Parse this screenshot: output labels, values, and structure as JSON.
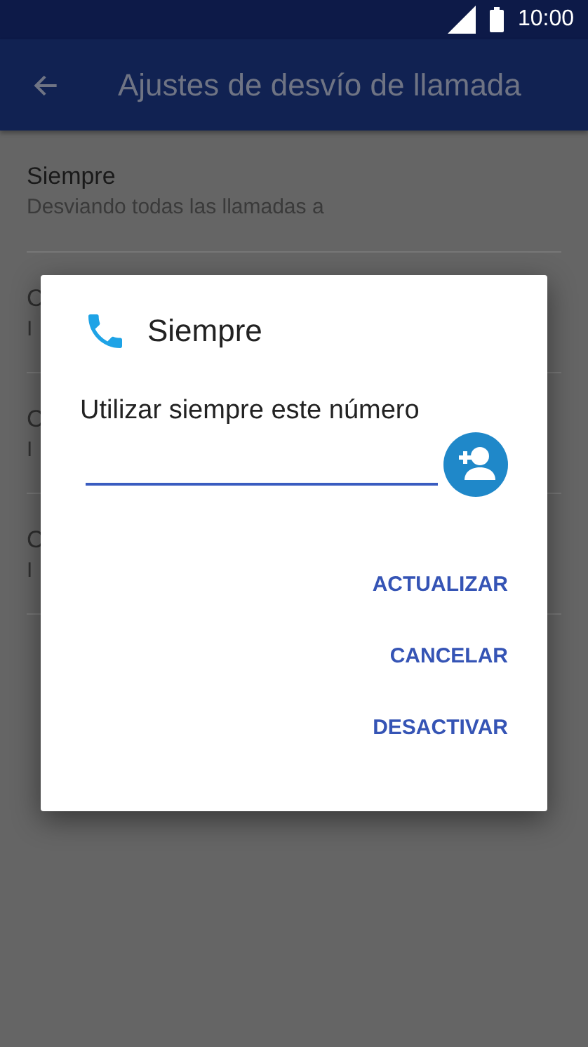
{
  "status_bar": {
    "time": "10:00"
  },
  "toolbar": {
    "title": "Ajustes de desvío de llamada"
  },
  "settings": [
    {
      "title": "Siempre",
      "subtitle": "Desviando todas las llamadas a",
      "disabled": false
    },
    {
      "title": "C",
      "subtitle": "I",
      "disabled": true
    },
    {
      "title": "C",
      "subtitle": "I",
      "disabled": true
    },
    {
      "title": "C",
      "subtitle": "I",
      "disabled": true
    }
  ],
  "dialog": {
    "title": "Siempre",
    "message": "Utilizar siempre este número",
    "buttons": [
      "ACTUALIZAR",
      "CANCELAR",
      "DESACTIVAR"
    ]
  }
}
